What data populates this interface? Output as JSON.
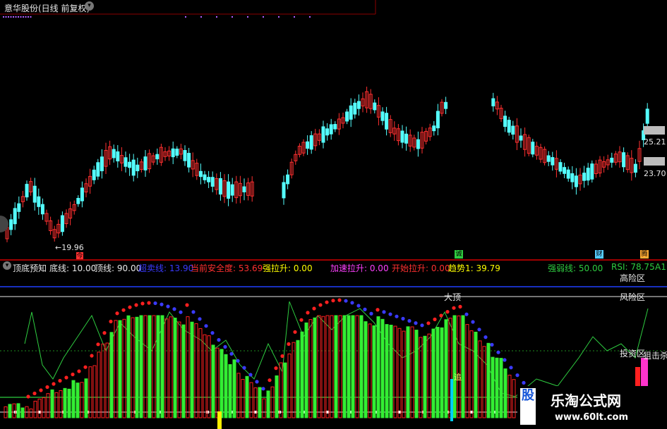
{
  "main_chart": {
    "title": "意华股份(日线 前复权)",
    "low_marker": "←19.96",
    "price_right_1": "25.21",
    "price_right_2": "23.70",
    "signal_tags": [
      "诚",
      "财",
      "腾",
      "今"
    ]
  },
  "indicator": {
    "name": "顶底预知",
    "params": [
      {
        "label": "底线: 10.00",
        "color": "#e8e8e8"
      },
      {
        "label": "顶线: 90.00",
        "color": "#e8e8e8"
      },
      {
        "label": "超卖线: 13.90",
        "color": "#3a3aff"
      },
      {
        "label": "当前安全度: 53.69",
        "color": "#ff3030"
      },
      {
        "label": "强拉升: 0.00",
        "color": "#ffff00"
      },
      {
        "label": "加速拉升: 0.00",
        "color": "#ff40ff"
      },
      {
        "label": "开始拉升: 0.00",
        "color": "#ff3030"
      },
      {
        "label": "趋势1: 39.79",
        "color": "#ffff00"
      },
      {
        "label": "强弱线: 50.00",
        "color": "#2ecc40"
      },
      {
        "label": "RSI: 78.75",
        "color": "#2ecc40"
      },
      {
        "label": "A1",
        "color": "#2ecc40"
      }
    ],
    "zone_labels": {
      "high_risk": "高险区",
      "risk": "风险区",
      "top": "大顶",
      "invest": "投资区",
      "snipe": "狙击杀",
      "chase": "追"
    }
  },
  "watermark": {
    "glyph": "股",
    "site_name": "乐淘公式网",
    "url": "www.60lt.com"
  },
  "colors": {
    "up": "#ff3030",
    "down": "#54ffff",
    "bg": "#000000"
  }
}
